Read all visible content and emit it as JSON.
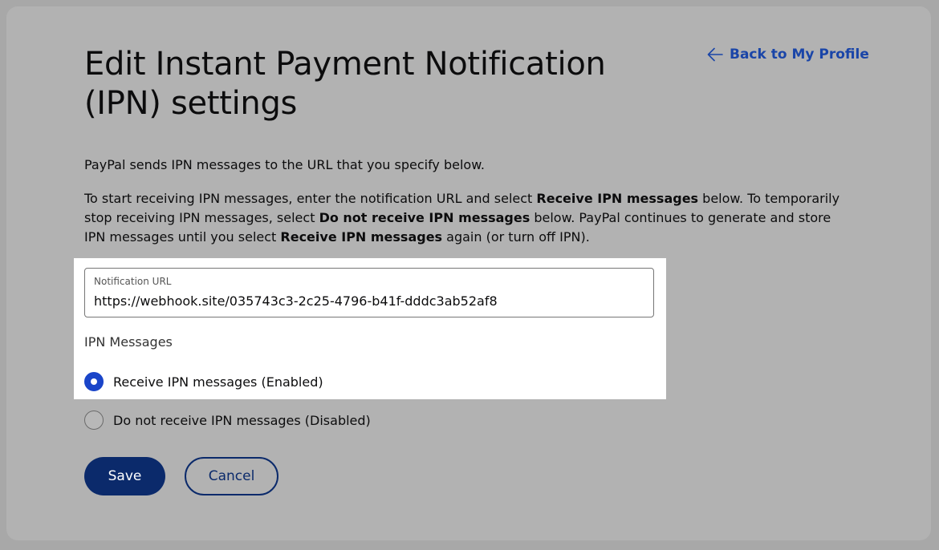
{
  "header": {
    "title": "Edit Instant Payment Notification (IPN) settings",
    "back_link": "Back to My Profile"
  },
  "intro": "PayPal sends IPN messages to the URL that you specify below.",
  "instructions": {
    "part1": "To start receiving IPN messages, enter the notification URL and select ",
    "bold1": "Receive IPN messages",
    "part2": " below. To temporarily stop receiving IPN messages, select ",
    "bold2": "Do not receive IPN messages",
    "part3": " below. PayPal continues to generate and store IPN messages until you select ",
    "bold3": "Receive IPN messages",
    "part4": " again (or turn off IPN)."
  },
  "notification_url": {
    "label": "Notification URL",
    "value": "https://webhook.site/035743c3-2c25-4796-b41f-dddc3ab52af8"
  },
  "ipn_messages": {
    "heading": "IPN Messages",
    "options": [
      {
        "label": "Receive IPN messages (Enabled)",
        "selected": true
      },
      {
        "label": "Do not receive IPN messages (Disabled)",
        "selected": false
      }
    ]
  },
  "actions": {
    "save": "Save",
    "cancel": "Cancel"
  },
  "colors": {
    "link": "#1a45a8",
    "primary_button": "#0b2a6b",
    "radio_selected": "#1a45c9",
    "overlay": "#a8a8a8"
  },
  "icons": {
    "back": "arrow-left-icon"
  }
}
